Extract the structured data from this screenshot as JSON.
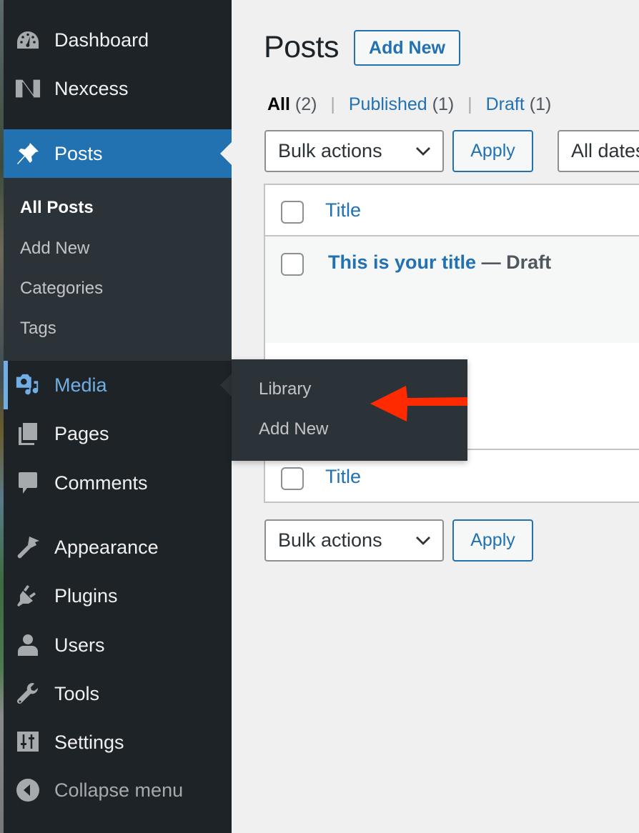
{
  "sidebar": {
    "items": [
      {
        "id": "dashboard",
        "label": "Dashboard",
        "icon": "dashboard-icon"
      },
      {
        "id": "nexcess",
        "label": "Nexcess",
        "icon": "nexcess-logo-icon"
      },
      {
        "id": "posts",
        "label": "Posts",
        "icon": "pushpin-icon",
        "state": "current"
      },
      {
        "id": "media",
        "label": "Media",
        "icon": "media-icon",
        "state": "hover"
      },
      {
        "id": "pages",
        "label": "Pages",
        "icon": "pages-icon"
      },
      {
        "id": "comments",
        "label": "Comments",
        "icon": "comment-bubble-icon"
      },
      {
        "id": "appearance",
        "label": "Appearance",
        "icon": "paintbrush-icon"
      },
      {
        "id": "plugins",
        "label": "Plugins",
        "icon": "plug-icon"
      },
      {
        "id": "users",
        "label": "Users",
        "icon": "user-icon"
      },
      {
        "id": "tools",
        "label": "Tools",
        "icon": "wrench-icon"
      },
      {
        "id": "settings",
        "label": "Settings",
        "icon": "sliders-icon"
      }
    ],
    "posts_submenu": [
      {
        "label": "All Posts",
        "current": true
      },
      {
        "label": "Add New"
      },
      {
        "label": "Categories"
      },
      {
        "label": "Tags"
      }
    ],
    "collapse_label": "Collapse menu"
  },
  "media_flyout": {
    "items": [
      {
        "label": "Library"
      },
      {
        "label": "Add New"
      }
    ],
    "annotation": {
      "type": "arrow",
      "color": "#ff2a00",
      "points_to": "Library"
    }
  },
  "main": {
    "title": "Posts",
    "add_new_label": "Add New",
    "filters": [
      {
        "label": "All",
        "count": "(2)",
        "current": true
      },
      {
        "label": "Published",
        "count": "(1)"
      },
      {
        "label": "Draft",
        "count": "(1)"
      }
    ],
    "bulk_actions_top": {
      "selected": "Bulk actions"
    },
    "apply_label": "Apply",
    "dates_filter": {
      "selected": "All dates"
    },
    "table": {
      "header_title": "Title",
      "rows": [
        {
          "title": "This is your title",
          "state": "— Draft"
        }
      ],
      "footer_title": "Title"
    },
    "bulk_actions_bottom": {
      "selected": "Bulk actions"
    }
  },
  "colors": {
    "sidebar_bg": "#1d2327",
    "submenu_bg": "#2c3338",
    "accent": "#2271b1",
    "hover": "#72aee6",
    "page_bg": "#f0f0f1"
  }
}
